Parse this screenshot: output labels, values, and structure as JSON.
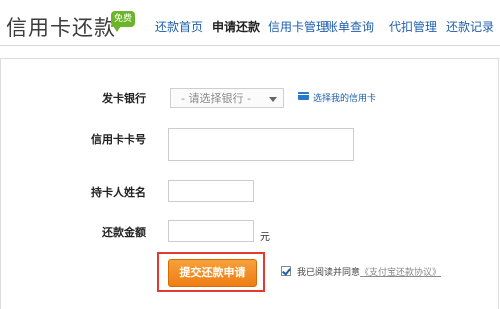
{
  "header": {
    "title": "信用卡还款",
    "badge": "免费"
  },
  "nav": {
    "items": [
      {
        "label": "还款首页",
        "active": false
      },
      {
        "label": "申请还款",
        "active": true
      },
      {
        "label": "信用卡管理",
        "active": false
      },
      {
        "label": "账单查询",
        "active": false
      },
      {
        "label": "代扣管理",
        "active": false
      },
      {
        "label": "还款记录",
        "active": false
      }
    ]
  },
  "form": {
    "bank_label": "发卡银行",
    "bank_select_value": "- 请选择银行 -",
    "select_my_card": "选择我的信用卡",
    "card_number_label": "信用卡卡号",
    "card_number_value": "",
    "holder_name_label": "持卡人姓名",
    "holder_name_value": "",
    "amount_label": "还款金额",
    "amount_value": "",
    "amount_unit": "元",
    "submit_label": "提交还款申请",
    "agree_checked": true,
    "agree_text": "我已阅读并同意",
    "agree_link": "《支付宝还款协议》"
  },
  "colors": {
    "link": "#1f5fae",
    "badge": "#6bb52a",
    "submit": "#ee7d14",
    "highlight": "#e23a2e"
  }
}
